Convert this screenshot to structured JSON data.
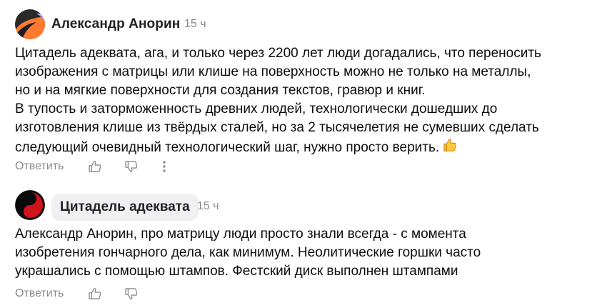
{
  "comments": [
    {
      "author": "Александр Анорин",
      "time": "15 ч",
      "text_lines": [
        "Цитадель адеквата, ага, и только через 2200 лет люди догадались, что переносить",
        "изображения с матрицы или клише на поверхность можно не только на металлы,",
        "но и на мягкие поверхности для создания текстов, гравюр и книг.",
        "В тупость и заторможенность древних людей, технологически дошедших до",
        "изготовления клише из твёрдых сталей, но за 2 тысячелетия не сумевших сделать",
        "следующий очевидный технологический шаг, нужно просто верить."
      ],
      "emoji": "thumbs-up-icon",
      "reply_label": "Ответить",
      "has_more_menu": true,
      "avatar_colors": [
        "#2a2a2a",
        "#ff7a2f",
        "#c9a3ff"
      ]
    },
    {
      "author": "Цитадель адеквата",
      "time": "15 ч",
      "text_lines": [
        "Александр Анорин, про матрицу люди просто знали всегда - с момента",
        "изобретения гончарного дела, как минимум. Неолитические горшки часто",
        "украшались с помощью штампов. Фестский диск выполнен штампами"
      ],
      "reply_label": "Ответить",
      "has_more_menu": false,
      "avatar_colors": [
        "#0a0a0a",
        "#d0141c"
      ]
    }
  ],
  "icons": {
    "like": "thumbs-up-outline-icon",
    "dislike": "thumbs-down-outline-icon",
    "more": "vertical-ellipsis-icon"
  },
  "colors": {
    "muted": "#8a8a8a",
    "author": "#222222",
    "chip_bg": "#f0f0f2"
  }
}
